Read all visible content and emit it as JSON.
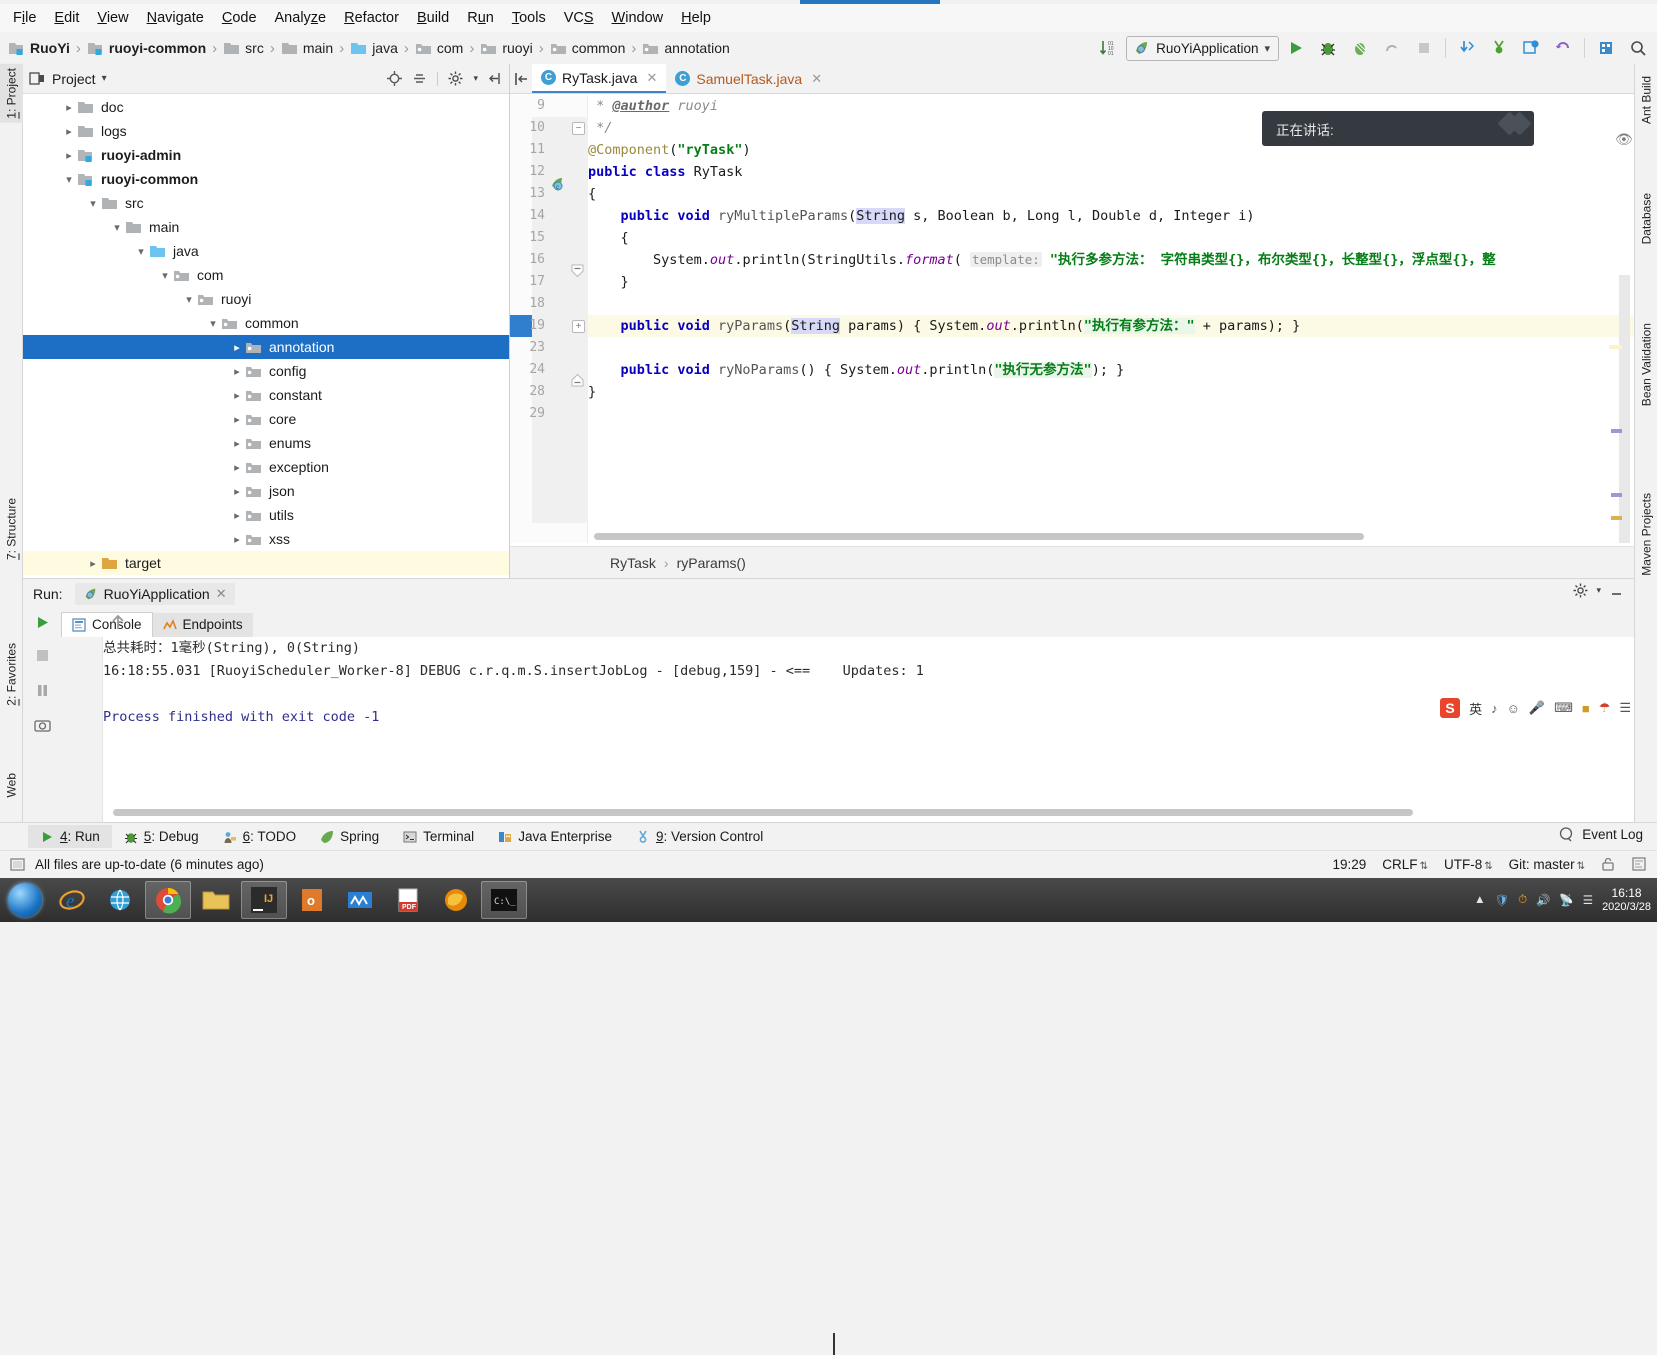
{
  "menubar": {
    "items": [
      {
        "pre": "F",
        "mnem": "i",
        "post": "le"
      },
      {
        "pre": "",
        "mnem": "E",
        "post": "dit"
      },
      {
        "pre": "",
        "mnem": "V",
        "post": "iew"
      },
      {
        "pre": "",
        "mnem": "N",
        "post": "avigate"
      },
      {
        "pre": "",
        "mnem": "C",
        "post": "ode"
      },
      {
        "pre": "Analy",
        "mnem": "z",
        "post": "e"
      },
      {
        "pre": "",
        "mnem": "R",
        "post": "efactor"
      },
      {
        "pre": "",
        "mnem": "B",
        "post": "uild"
      },
      {
        "pre": "R",
        "mnem": "u",
        "post": "n"
      },
      {
        "pre": "",
        "mnem": "T",
        "post": "ools"
      },
      {
        "pre": "VC",
        "mnem": "S",
        "post": ""
      },
      {
        "pre": "",
        "mnem": "W",
        "post": "indow"
      },
      {
        "pre": "",
        "mnem": "H",
        "post": "elp"
      }
    ]
  },
  "navbar": {
    "crumbs": [
      {
        "label": "RuoYi",
        "icon": "module-icon",
        "bold": true
      },
      {
        "label": "ruoyi-common",
        "icon": "module-icon",
        "bold": true
      },
      {
        "label": "src",
        "icon": "folder-icon",
        "bold": false
      },
      {
        "label": "main",
        "icon": "folder-icon",
        "bold": false
      },
      {
        "label": "java",
        "icon": "source-folder-icon",
        "bold": false
      },
      {
        "label": "com",
        "icon": "package-icon",
        "bold": false
      },
      {
        "label": "ruoyi",
        "icon": "package-icon",
        "bold": false
      },
      {
        "label": "common",
        "icon": "package-icon",
        "bold": false
      },
      {
        "label": "annotation",
        "icon": "package-icon",
        "bold": false
      }
    ],
    "run_config": "RuoYiApplication",
    "icons": [
      "sort-icon",
      "run-icon",
      "debug-icon",
      "coverage-icon",
      "profile-icon",
      "stop-icon",
      "update-project-icon",
      "commit-icon",
      "history-icon",
      "undo-icon",
      "database-icon",
      "search-icon"
    ]
  },
  "left_strip": {
    "items": [
      {
        "num": "1",
        "label": "Project"
      },
      {
        "num": "7",
        "label": "Structure"
      },
      {
        "num": "2",
        "label": "Favorites"
      },
      {
        "num": "",
        "label": "Web"
      }
    ]
  },
  "right_strip": {
    "items": [
      {
        "label": "Ant Build"
      },
      {
        "label": "Database"
      },
      {
        "label": "Bean Validation"
      },
      {
        "label": "Maven Projects"
      }
    ]
  },
  "project_panel": {
    "title": "Project",
    "header_icons": [
      "locate-icon",
      "collapse-all-icon",
      "gear-icon",
      "hide-icon"
    ],
    "tree": [
      {
        "label": "doc",
        "depth": 1,
        "arrow": "right",
        "icon": "folder-icon",
        "bold": false,
        "selected": false
      },
      {
        "label": "logs",
        "depth": 1,
        "arrow": "right",
        "icon": "folder-icon",
        "bold": false,
        "selected": false
      },
      {
        "label": "ruoyi-admin",
        "depth": 1,
        "arrow": "right",
        "icon": "module-icon",
        "bold": true,
        "selected": false
      },
      {
        "label": "ruoyi-common",
        "depth": 1,
        "arrow": "down",
        "icon": "module-icon",
        "bold": true,
        "selected": false
      },
      {
        "label": "src",
        "depth": 2,
        "arrow": "down",
        "icon": "folder-icon",
        "bold": false,
        "selected": false
      },
      {
        "label": "main",
        "depth": 3,
        "arrow": "down",
        "icon": "folder-icon",
        "bold": false,
        "selected": false
      },
      {
        "label": "java",
        "depth": 4,
        "arrow": "down",
        "icon": "source-folder-icon",
        "bold": false,
        "selected": false
      },
      {
        "label": "com",
        "depth": 5,
        "arrow": "down",
        "icon": "package-icon",
        "bold": false,
        "selected": false
      },
      {
        "label": "ruoyi",
        "depth": 6,
        "arrow": "down",
        "icon": "package-icon",
        "bold": false,
        "selected": false
      },
      {
        "label": "common",
        "depth": 7,
        "arrow": "down",
        "icon": "package-icon",
        "bold": false,
        "selected": false
      },
      {
        "label": "annotation",
        "depth": 8,
        "arrow": "right",
        "icon": "package-icon",
        "bold": false,
        "selected": true
      },
      {
        "label": "config",
        "depth": 8,
        "arrow": "right",
        "icon": "package-icon",
        "bold": false,
        "selected": false
      },
      {
        "label": "constant",
        "depth": 8,
        "arrow": "right",
        "icon": "package-icon",
        "bold": false,
        "selected": false
      },
      {
        "label": "core",
        "depth": 8,
        "arrow": "right",
        "icon": "package-icon",
        "bold": false,
        "selected": false
      },
      {
        "label": "enums",
        "depth": 8,
        "arrow": "right",
        "icon": "package-icon",
        "bold": false,
        "selected": false
      },
      {
        "label": "exception",
        "depth": 8,
        "arrow": "right",
        "icon": "package-icon",
        "bold": false,
        "selected": false
      },
      {
        "label": "json",
        "depth": 8,
        "arrow": "right",
        "icon": "package-icon",
        "bold": false,
        "selected": false
      },
      {
        "label": "utils",
        "depth": 8,
        "arrow": "right",
        "icon": "package-icon",
        "bold": false,
        "selected": false
      },
      {
        "label": "xss",
        "depth": 8,
        "arrow": "right",
        "icon": "package-icon",
        "bold": false,
        "selected": false
      },
      {
        "label": "target",
        "depth": 2,
        "arrow": "right",
        "icon": "folder-orange-icon",
        "bold": false,
        "selected": false
      }
    ]
  },
  "editor": {
    "tabs": [
      {
        "label": "RyTask.java",
        "active": true,
        "modified": false
      },
      {
        "label": "SamuelTask.java",
        "active": false,
        "modified": true
      }
    ],
    "line_numbers": [
      "9",
      "10",
      "11",
      "12",
      "13",
      "14",
      "15",
      "16",
      "17",
      "18",
      "19",
      "23",
      "24",
      "28",
      "29"
    ],
    "caret_line_index": 10,
    "breadcrumb": [
      "RyTask",
      "ryParams()"
    ],
    "code": {
      "l9_comment": " * ",
      "l9_author": "@author",
      "l9_name": " ruoyi",
      "l10": " */",
      "l11_ann": "@Component",
      "l11_open": "(",
      "l11_str": "\"ryTask\"",
      "l11_close": ")",
      "l12_kw": "public class ",
      "l12_name": "RyTask",
      "l13": "{",
      "l14_kw": "    public void ",
      "l14_name": "ryMultipleParams",
      "l14_p1": "(",
      "l14_String": "String",
      "l14_rest": " s, Boolean b, Long l, Double d, Integer i)",
      "l15": "    {",
      "l16_a": "        System.",
      "l16_out": "out",
      "l16_b": ".println(StringUtils.",
      "l16_format": "format",
      "l16_c": "( ",
      "l16_hint": "template:",
      "l16_str": " \"执行多参方法： 字符串类型{}，布尔类型{}，长整型{}，浮点型{}，整",
      "l17": "    }",
      "l18": "",
      "l19_kw": "    public void ",
      "l19_name": "ryParams",
      "l19_p1": "(",
      "l19_String": "String",
      "l19_p2": " params) { System.",
      "l19_out": "out",
      "l19_p3": ".println(",
      "l19_str": "\"执行有参方法：\"",
      "l19_p4": " + params); }",
      "l23": "",
      "l24_kw": "    public void ",
      "l24_name": "ryNoParams",
      "l24_p1": "() { System.",
      "l24_out": "out",
      "l24_p2": ".println(",
      "l24_str": "\"执行无参方法\"",
      "l24_p3": "); }",
      "l28": "}",
      "l29": ""
    }
  },
  "toast": {
    "text": "正在讲话:"
  },
  "run_panel": {
    "label": "Run:",
    "config_tab": "RuoYiApplication",
    "tabs": [
      {
        "label": "Console",
        "icon": "console-icon",
        "active": true
      },
      {
        "label": "Endpoints",
        "icon": "endpoints-icon",
        "active": false
      }
    ],
    "console_lines": [
      {
        "text": "总共耗时：1毫秒(String), 0(String)",
        "blue": false
      },
      {
        "text": "16:18:55.031 [RuoyiScheduler_Worker-8] DEBUG c.r.q.m.S.insertJobLog - [debug,159] - <==    Updates: 1",
        "blue": false
      },
      {
        "text": "",
        "blue": false
      },
      {
        "text": "Process finished with exit code -1",
        "blue": true
      }
    ],
    "side_buttons": [
      "rerun-icon",
      "stop-icon",
      "pause-icon",
      "camera-icon"
    ],
    "nav_buttons": [
      "scroll-up-icon",
      "scroll-down-icon",
      "soft-wrap-icon"
    ],
    "settings_icons": [
      "gear-icon",
      "minimize-icon"
    ]
  },
  "ime": {
    "logo": "S",
    "mode": "英",
    "icons": [
      "voice-icon",
      "emoji-icon",
      "mic-icon",
      "keyboard-icon",
      "toolbox-icon",
      "umbrella-icon",
      "menu-icon"
    ]
  },
  "bottom_tabs": [
    {
      "num": "4",
      "label": "Run",
      "icon": "run-icon",
      "active": true
    },
    {
      "num": "5",
      "label": "Debug",
      "icon": "debug-icon",
      "active": false
    },
    {
      "num": "6",
      "label": "TODO",
      "icon": "todo-icon",
      "active": false
    },
    {
      "num": "",
      "label": "Spring",
      "icon": "spring-icon",
      "active": false
    },
    {
      "num": "",
      "label": "Terminal",
      "icon": "terminal-icon",
      "active": false
    },
    {
      "num": "",
      "label": "Java Enterprise",
      "icon": "java-ee-icon",
      "active": false
    },
    {
      "num": "9",
      "label": "Version Control",
      "icon": "vcs-icon",
      "active": false
    }
  ],
  "event_log": {
    "label": "Event Log",
    "icon": "event-log-icon"
  },
  "status_bar": {
    "message": "All files are up-to-date (6 minutes ago)",
    "caret_position": "19:29",
    "line_separator": "CRLF",
    "encoding": "UTF-8",
    "branch": "Git: master",
    "icons": [
      "lock-icon",
      "inspections-icon"
    ]
  },
  "taskbar": {
    "icons": [
      "start-orb",
      "ie-icon",
      "network-icon",
      "chrome-icon",
      "explorer-icon",
      "jetbrains-icon",
      "office-icon",
      "wps-icon",
      "pdf-icon",
      "firefox-icon",
      "cmd-icon"
    ],
    "tray_icons": [
      "show-hidden-icon",
      "shield-icon",
      "clock-sync-icon",
      "sound-icon",
      "network-icon",
      "signal-icon"
    ],
    "clock_time": "16:18",
    "clock_date": "2020/3/28"
  },
  "colors": {
    "accent": "#2675bf",
    "selection": "#1c6fc4",
    "keyword": "#0a00c0",
    "string": "#067d17",
    "annotation": "#9a8a3a",
    "field": "#7a0094",
    "line_highlight": "#fcf9e4",
    "taskbar": "#2e2e2e"
  }
}
